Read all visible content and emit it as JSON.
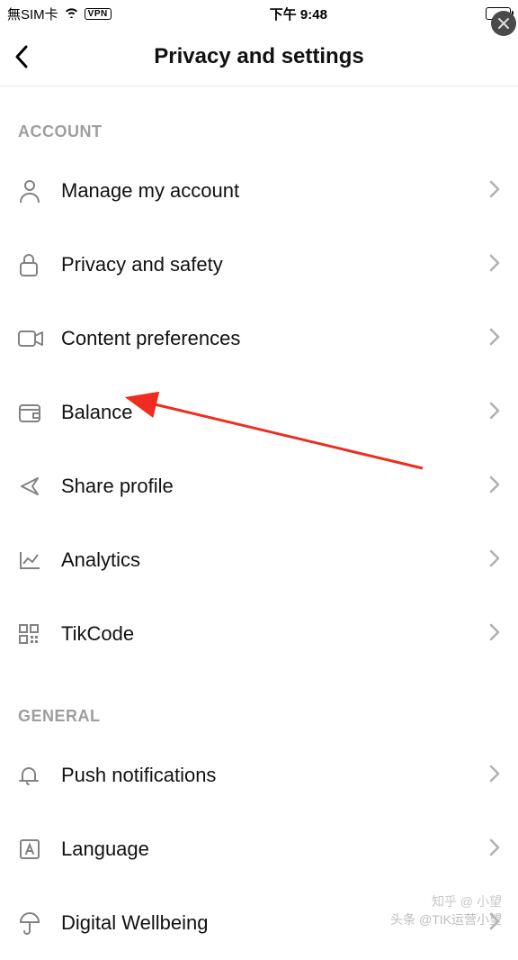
{
  "statusbar": {
    "carrier": "無SIM卡",
    "vpn": "VPN",
    "time": "下午 9:48"
  },
  "header": {
    "title": "Privacy and settings"
  },
  "sections": {
    "account": {
      "title": "ACCOUNT",
      "items": [
        {
          "label": "Manage my account"
        },
        {
          "label": "Privacy and safety"
        },
        {
          "label": "Content preferences"
        },
        {
          "label": "Balance"
        },
        {
          "label": "Share profile"
        },
        {
          "label": "Analytics"
        },
        {
          "label": "TikCode"
        }
      ]
    },
    "general": {
      "title": "GENERAL",
      "items": [
        {
          "label": "Push notifications"
        },
        {
          "label": "Language"
        },
        {
          "label": "Digital Wellbeing"
        }
      ]
    }
  },
  "watermark": {
    "line1": "知乎 @ 小望",
    "line2": "头条 @TIK运营小望"
  }
}
